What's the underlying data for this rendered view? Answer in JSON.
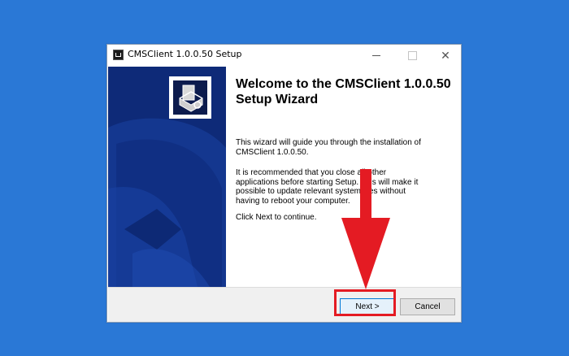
{
  "window": {
    "title": "CMSClient 1.0.0.50 Setup",
    "controls": {
      "minimize": "minimize",
      "maximize": "maximize",
      "close": "✕"
    }
  },
  "banner": {
    "logo_icon": "installer-box-icon"
  },
  "content": {
    "heading": "Welcome to the CMSClient 1.0.0.50 Setup Wizard",
    "para1": "This wizard will guide you through the installation of CMSClient 1.0.0.50.",
    "para2": "It is recommended that you close all other applications before starting Setup. This will make it possible to update relevant system files without having to reboot your computer.",
    "para3": "Click Next to continue."
  },
  "footer": {
    "next_label": "Next >",
    "cancel_label": "Cancel"
  },
  "annotation": {
    "arrow_color": "#e41b23",
    "box_color": "#e41b23"
  },
  "colors": {
    "desktop": "#2a78d6",
    "banner": "#0e2a78",
    "footer": "#f0f0f0"
  }
}
